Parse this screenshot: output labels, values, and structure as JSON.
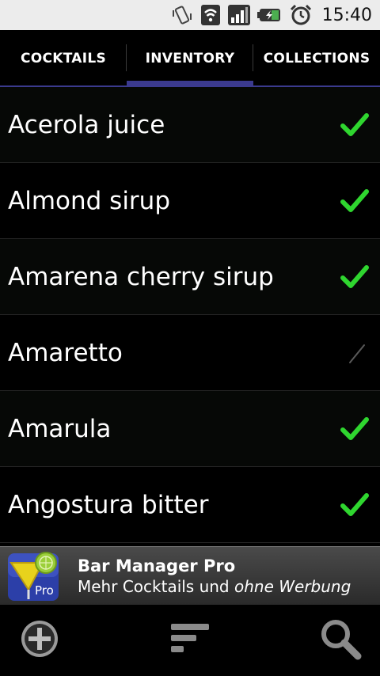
{
  "status_bar": {
    "time": "15:40",
    "icons": [
      "vibrate-icon",
      "wifi-icon",
      "signal-icon",
      "battery-charging-icon",
      "alarm-clock-icon"
    ]
  },
  "tabs": [
    {
      "label": "COCKTAILS",
      "active": false
    },
    {
      "label": "INVENTORY",
      "active": true
    },
    {
      "label": "COLLECTIONS",
      "active": false
    }
  ],
  "inventory": [
    {
      "name": "Acerola juice",
      "checked": true
    },
    {
      "name": "Almond sirup",
      "checked": true
    },
    {
      "name": "Amarena cherry sirup",
      "checked": true
    },
    {
      "name": "Amaretto",
      "checked": false
    },
    {
      "name": "Amarula",
      "checked": true
    },
    {
      "name": "Angostura bitter",
      "checked": true
    }
  ],
  "promo": {
    "logo_badge": "Pro",
    "title": "Bar Manager Pro",
    "subtitle_normal": "Mehr Cocktails und ",
    "subtitle_italic": "ohne Werbung"
  },
  "toolbar": {
    "icons": [
      "add-icon",
      "sort-icon",
      "search-icon"
    ]
  },
  "colors": {
    "accent": "#3b3a8e",
    "check_on": "#2fd62f",
    "check_off": "#5a5a5a"
  }
}
